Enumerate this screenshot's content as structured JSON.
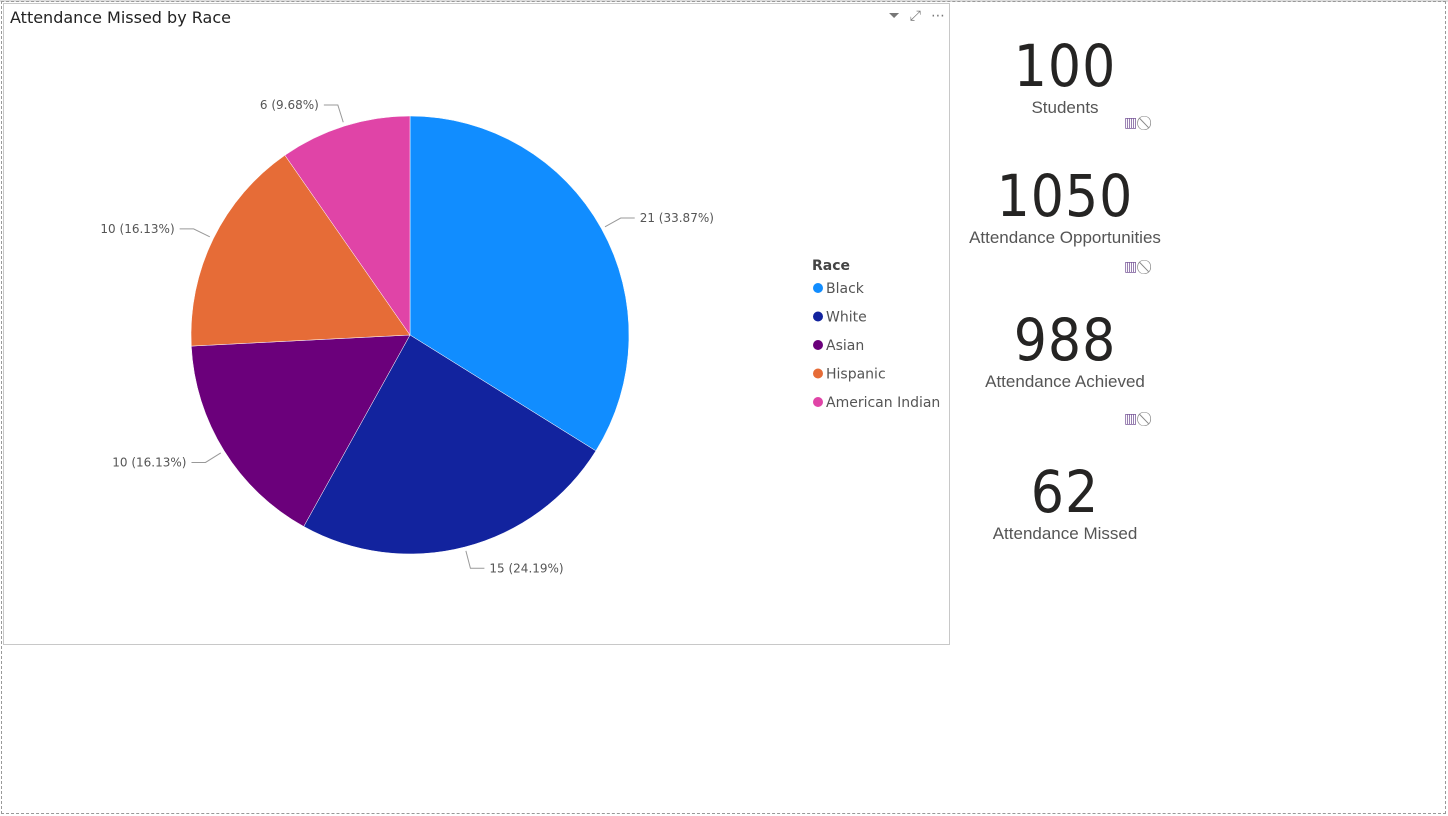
{
  "visual": {
    "title": "Attendance Missed by Race",
    "icons": [
      "filter-icon",
      "focus-mode-icon",
      "more-options-icon"
    ]
  },
  "chart_data": {
    "type": "pie",
    "title": "Attendance Missed by Race",
    "legend_title": "Race",
    "legend_position": "right",
    "categories": [
      "Black",
      "White",
      "Asian",
      "Hispanic",
      "American Indian"
    ],
    "values": [
      21,
      15,
      10,
      10,
      6
    ],
    "percents": [
      33.87,
      24.19,
      16.13,
      16.13,
      9.68
    ],
    "data_labels": [
      "21 (33.87%)",
      "15 (24.19%)",
      "10 (16.13%)",
      "10 (16.13%)",
      "6 (9.68%)"
    ],
    "colors": [
      "#118DFF",
      "#12239E",
      "#6B007B",
      "#E66C37",
      "#E044A7"
    ]
  },
  "cards": [
    {
      "value": "100",
      "label": "Students"
    },
    {
      "value": "1050",
      "label": "Attendance Opportunities"
    },
    {
      "value": "988",
      "label": "Attendance Achieved"
    },
    {
      "value": "62",
      "label": "Attendance Missed"
    }
  ]
}
